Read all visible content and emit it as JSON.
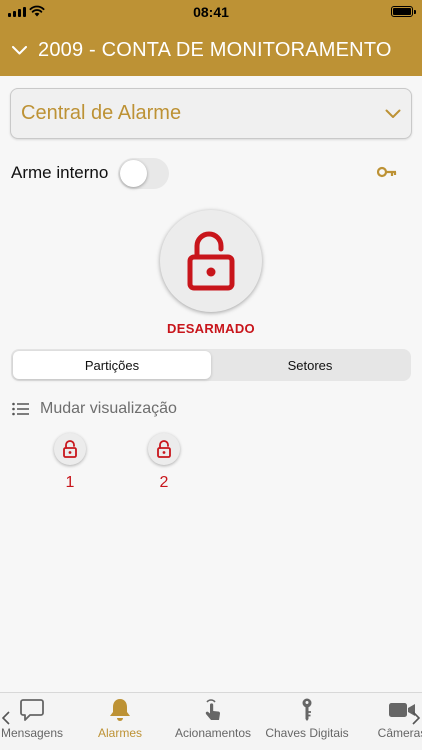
{
  "status_bar": {
    "time": "08:41"
  },
  "header": {
    "title": "2009 - CONTA DE MONITORAMENTO",
    "back_icon": "chevron-down-icon"
  },
  "device_select": {
    "value": "Central de Alarme"
  },
  "arm_internal": {
    "label": "Arme interno",
    "enabled": false
  },
  "alarm": {
    "status": "DESARMADO",
    "status_color": "#c8151b",
    "lock_state": "unlocked"
  },
  "segments": {
    "items": [
      "Partições",
      "Setores"
    ],
    "selected": "Partições"
  },
  "view_toggle": {
    "label": "Mudar visualização"
  },
  "partitions": [
    {
      "number": "1",
      "state": "unlocked"
    },
    {
      "number": "2",
      "state": "unlocked"
    }
  ],
  "tab_bar": {
    "items": [
      {
        "label": "Mensagens",
        "icon": "message-icon",
        "active": false
      },
      {
        "label": "Alarmes",
        "icon": "bell-icon",
        "active": true
      },
      {
        "label": "Acionamentos",
        "icon": "hand-tap-icon",
        "active": false
      },
      {
        "label": "Chaves Digitais",
        "icon": "key-icon",
        "active": false
      },
      {
        "label": "Câmeras",
        "icon": "video-camera-icon",
        "active": false
      }
    ]
  },
  "colors": {
    "brand": "#bd9235",
    "danger": "#c8151b"
  }
}
